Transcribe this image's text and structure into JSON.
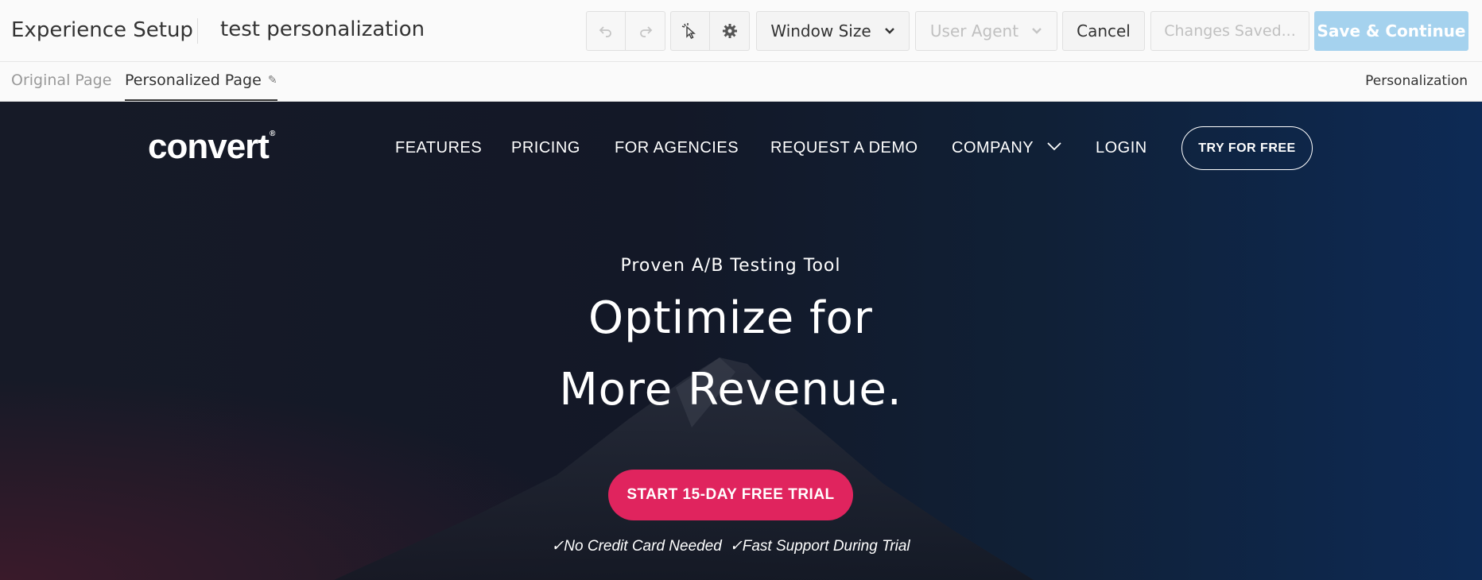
{
  "editor": {
    "app_title": "Experience Setup",
    "experience_name": "test personalization",
    "toolbar": {
      "undo_icon": "undo-icon",
      "redo_icon": "redo-icon",
      "select_icon": "pointer-select-icon",
      "settings_icon": "gear-icon",
      "window_size_label": "Window Size",
      "user_agent_label": "User Agent",
      "cancel_label": "Cancel",
      "status_label": "Changes Saved...",
      "save_label": "Save & Continue"
    },
    "tabs": [
      {
        "label": "Original Page",
        "active": false
      },
      {
        "label": "Personalized Page",
        "active": true
      }
    ],
    "experience_type": "Personalization"
  },
  "site": {
    "logo_text": "convert",
    "logo_mark": "®",
    "nav": {
      "features": "FEATURES",
      "pricing": "PRICING",
      "agencies": "FOR AGENCIES",
      "demo": "REQUEST A DEMO",
      "company": "COMPANY",
      "login": "LOGIN",
      "try": "TRY FOR FREE"
    },
    "hero": {
      "kicker": "Proven A/B Testing Tool",
      "line1": "Optimize for",
      "line2": "More Revenue.",
      "cta": "START 15-DAY FREE TRIAL",
      "assurance1": "✓No Credit Card Needed",
      "assurance2": "✓Fast Support During Trial"
    }
  },
  "colors": {
    "save_button": "#a5d2ee",
    "cta": "#e0245e",
    "hero_bg": "#131827"
  }
}
